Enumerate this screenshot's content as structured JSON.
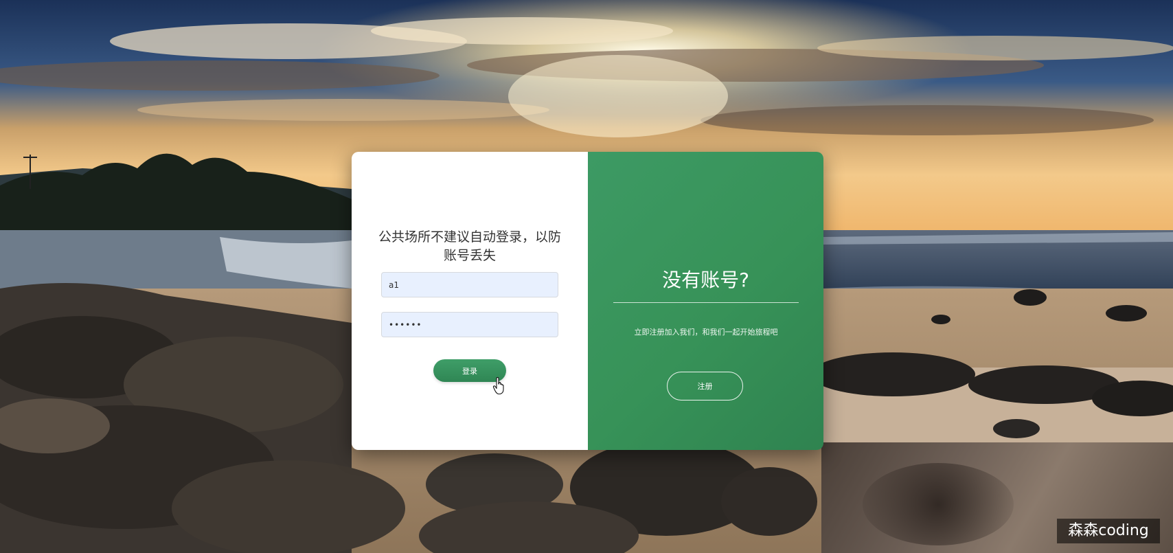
{
  "login": {
    "notice": "公共场所不建议自动登录，以防账号丢失",
    "username_value": "a1",
    "password_value": "••••••",
    "login_button": "登录"
  },
  "register": {
    "title": "没有账号?",
    "description": "立即注册加入我们，和我们一起开始旅程吧",
    "register_button": "注册"
  },
  "watermark": "森森coding",
  "colors": {
    "accent_green": "#3a9660",
    "card_left": "#ffffff",
    "input_fill": "#e8f0fe"
  },
  "icons": {
    "cursor": "hand-pointer-icon"
  }
}
